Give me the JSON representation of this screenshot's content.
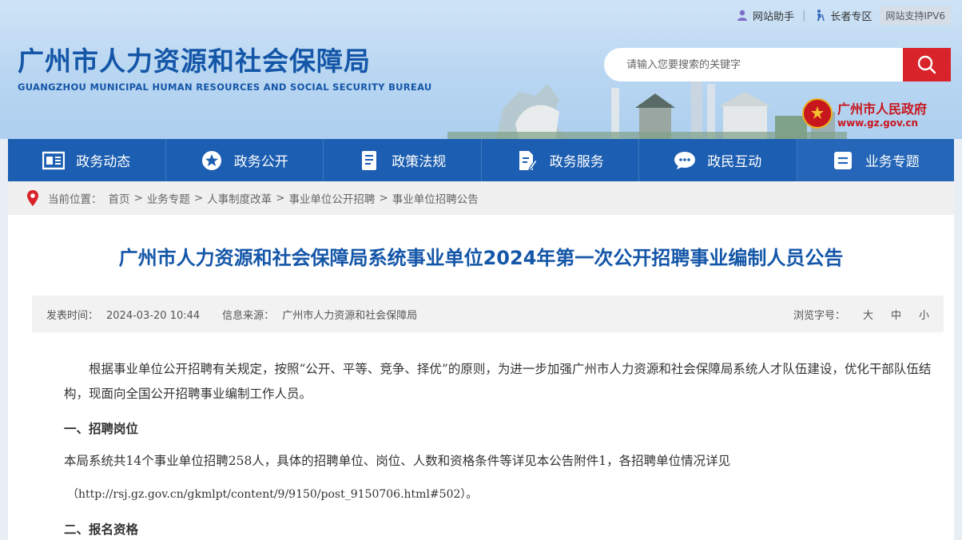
{
  "topbar": {
    "assistant": "网站助手",
    "elder": "长者专区",
    "ipv6": "网站支持IPV6"
  },
  "logo": {
    "cn": "广州市人力资源和社会保障局",
    "en": "GUANGZHOU MUNICIPAL HUMAN RESOURCES AND SOCIAL SECURITY BUREAU"
  },
  "search": {
    "placeholder": "请输入您要搜索的关键字"
  },
  "gov": {
    "name": "广州市人民政府",
    "url": "www.gz.gov.cn"
  },
  "nav": [
    {
      "label": "政务动态",
      "icon": "news-icon"
    },
    {
      "label": "政务公开",
      "icon": "star-icon"
    },
    {
      "label": "政策法规",
      "icon": "document-icon"
    },
    {
      "label": "政务服务",
      "icon": "edit-document-icon"
    },
    {
      "label": "政民互动",
      "icon": "chat-icon"
    },
    {
      "label": "业务专题",
      "icon": "list-icon"
    }
  ],
  "breadcrumb": {
    "prefix": "当前位置：",
    "items": [
      "首页",
      "业务专题",
      "人事制度改革",
      "事业单位公开招聘",
      "事业单位招聘公告"
    ]
  },
  "article": {
    "title": "广州市人力资源和社会保障局系统事业单位2024年第一次公开招聘事业编制人员公告",
    "meta": {
      "date_label": "发表时间：",
      "date": "2024-03-20 10:44",
      "source_label": "信息来源：",
      "source": "广州市人力资源和社会保障局",
      "font_label": "浏览字号：",
      "sizes": [
        "大",
        "中",
        "小"
      ]
    },
    "p1": "根据事业单位公开招聘有关规定，按照“公开、平等、竞争、择优”的原则，为进一步加强广州市人力资源和社会保障局系统人才队伍建设，优化干部队伍结构，现面向全国公开招聘事业编制工作人员。",
    "h1": "一、招聘岗位",
    "p2": "本局系统共14个事业单位招聘258人，具体的招聘单位、岗位、人数和资格条件等详见本公告附件1，各招聘单位情况详见",
    "p3": "（http://rsj.gz.gov.cn/gkmlpt/content/9/9150/post_9150706.html#502）。",
    "h2": "二、报名资格"
  },
  "colors": {
    "brand_blue": "#1456a8",
    "nav_blue": "#1c5eb1",
    "search_red": "#d8232a"
  }
}
